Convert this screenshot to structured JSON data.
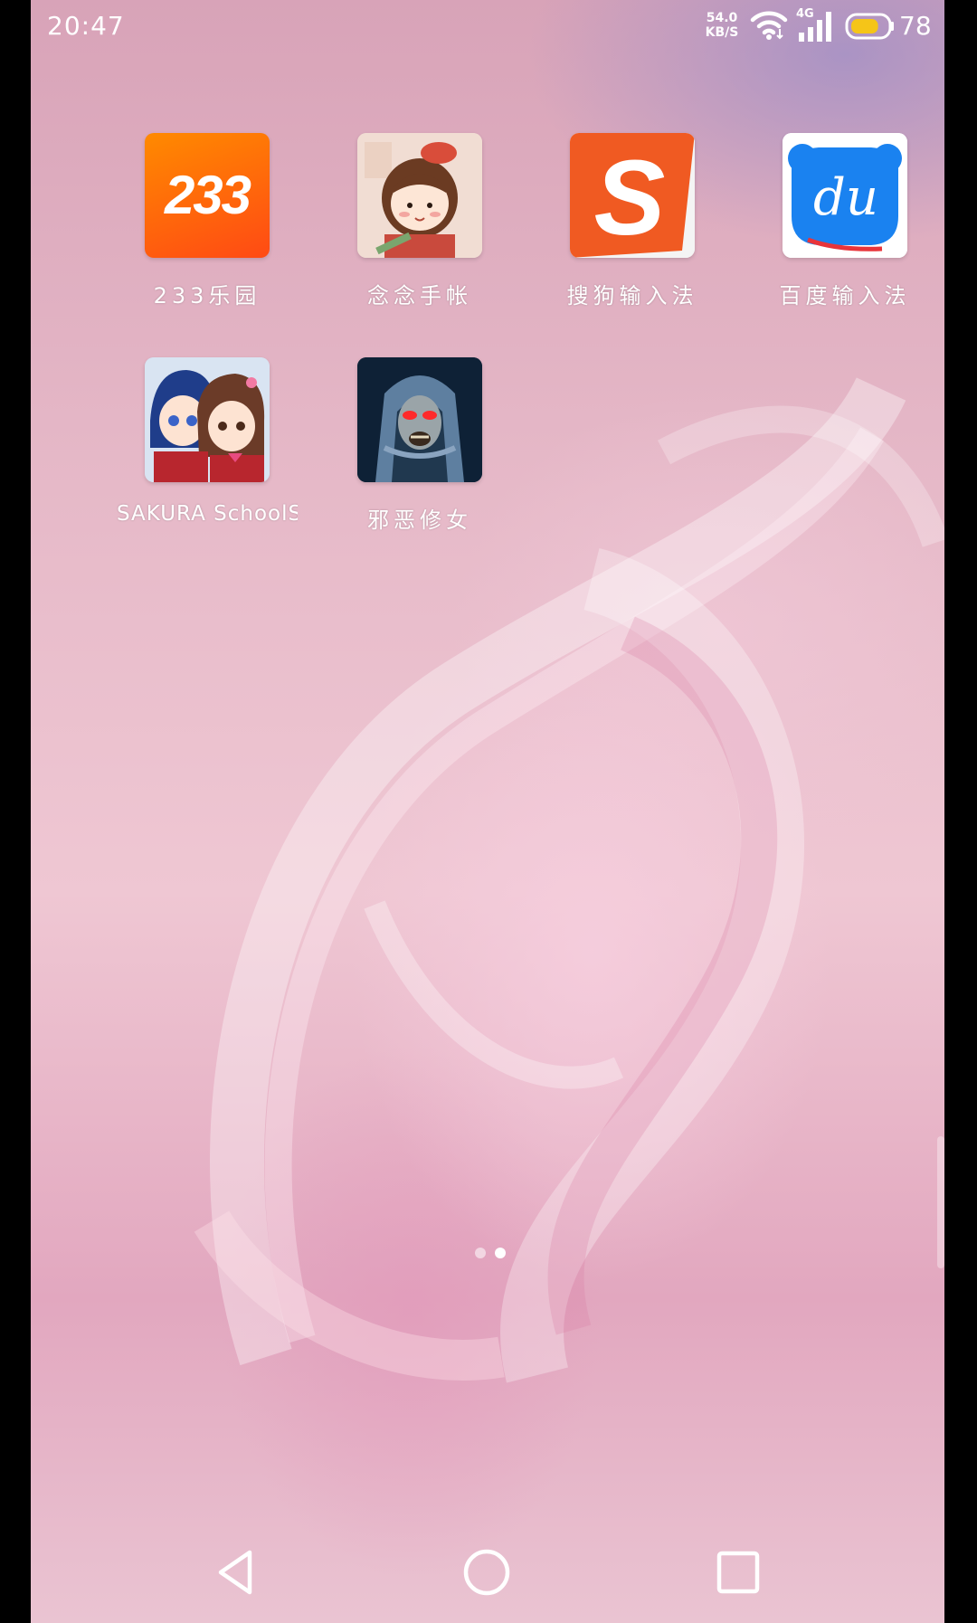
{
  "status_bar": {
    "time": "20:47",
    "net_speed_value": "54.0",
    "net_speed_unit": "KB/S",
    "network_type": "4G",
    "battery_level": "78",
    "battery_color": "#f5c518"
  },
  "apps": [
    {
      "label": "233乐园",
      "icon": "app-233-icon",
      "icon_text": "233",
      "color": "#ff5a0a"
    },
    {
      "label": "念念手帐",
      "icon": "app-diary-girl-icon",
      "color": "#f3d8cf"
    },
    {
      "label": "搜狗输入法",
      "icon": "app-sogou-icon",
      "icon_text": "S",
      "color": "#f05a22"
    },
    {
      "label": "百度输入法",
      "icon": "app-baidu-du-icon",
      "icon_text": "du",
      "color": "#1a82f0"
    },
    {
      "label": "SAKURA SchoolS…",
      "icon": "app-sakura-school-icon",
      "color": "#c9d8f0"
    },
    {
      "label": "邪恶修女",
      "icon": "app-evil-nun-icon",
      "color": "#0f2a44"
    }
  ],
  "page_indicator": {
    "pages": 2,
    "current": 2,
    "active_color": "#ffffff",
    "inactive_color": "rgba(255,255,255,0.55)"
  },
  "nav_bar": {
    "back": "back-triangle-icon",
    "home": "home-circle-icon",
    "recents": "recents-square-icon"
  }
}
